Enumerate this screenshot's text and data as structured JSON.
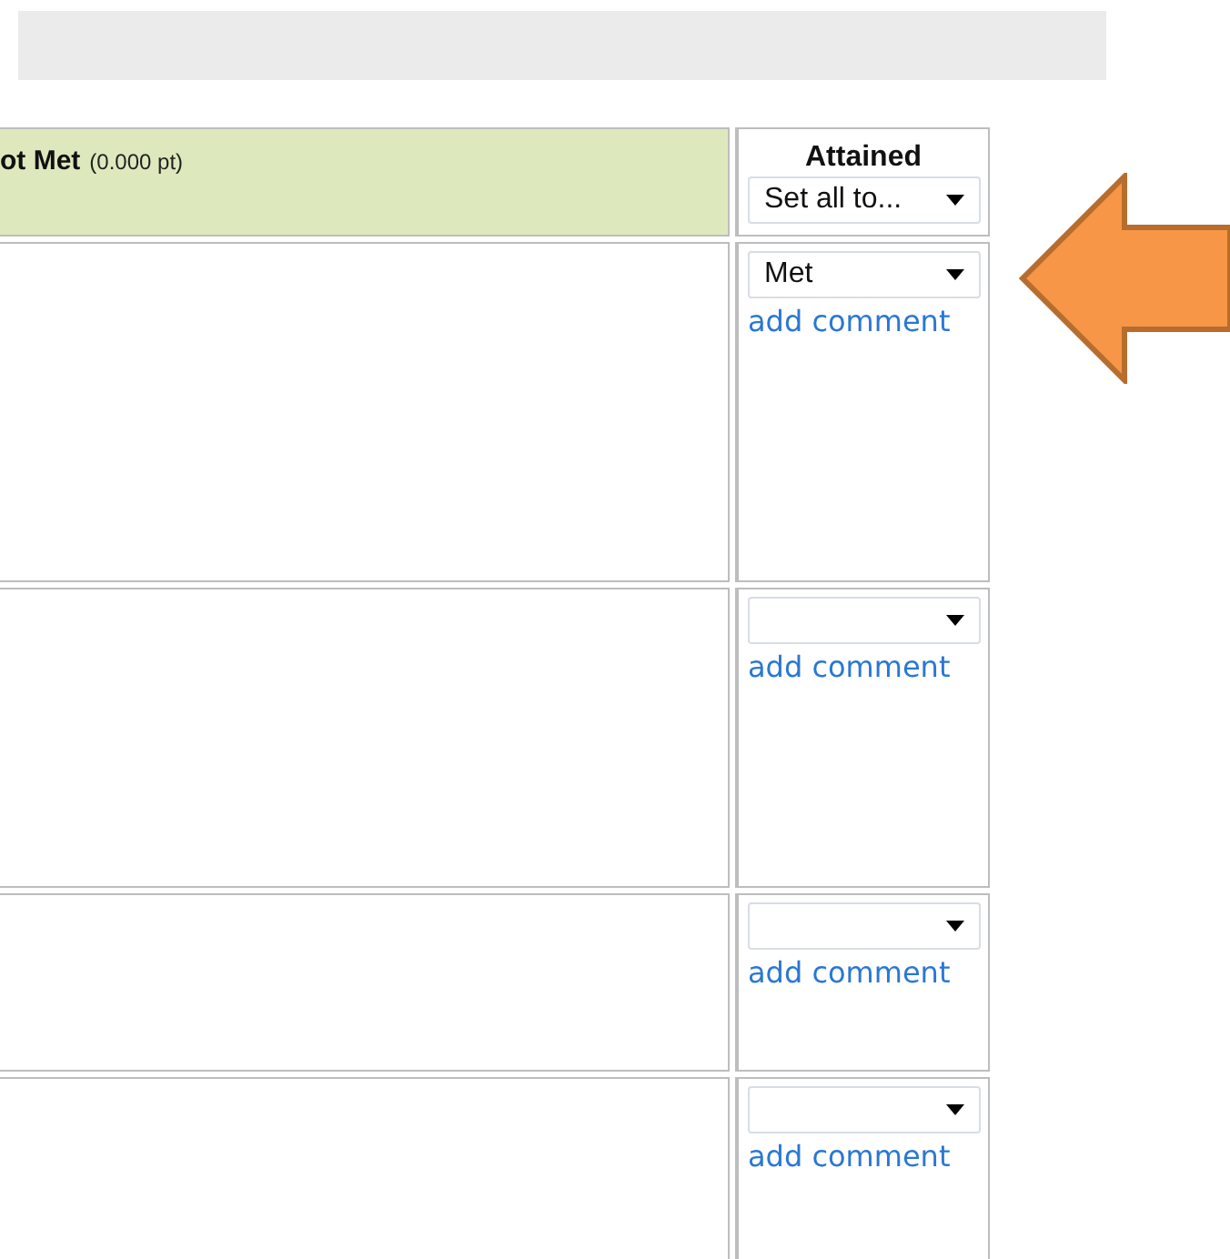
{
  "header": {
    "title": "ot Met",
    "points": "(0.000 pt)",
    "attained_label": "Attained",
    "set_all": {
      "value": "Set all to..."
    }
  },
  "rows": [
    {
      "attained": {
        "value": "Met"
      },
      "link": "add comment"
    },
    {
      "attained": {},
      "link": "add comment"
    },
    {
      "attained": {},
      "link": "add comment"
    },
    {
      "attained": {},
      "link": "add comment"
    }
  ]
}
